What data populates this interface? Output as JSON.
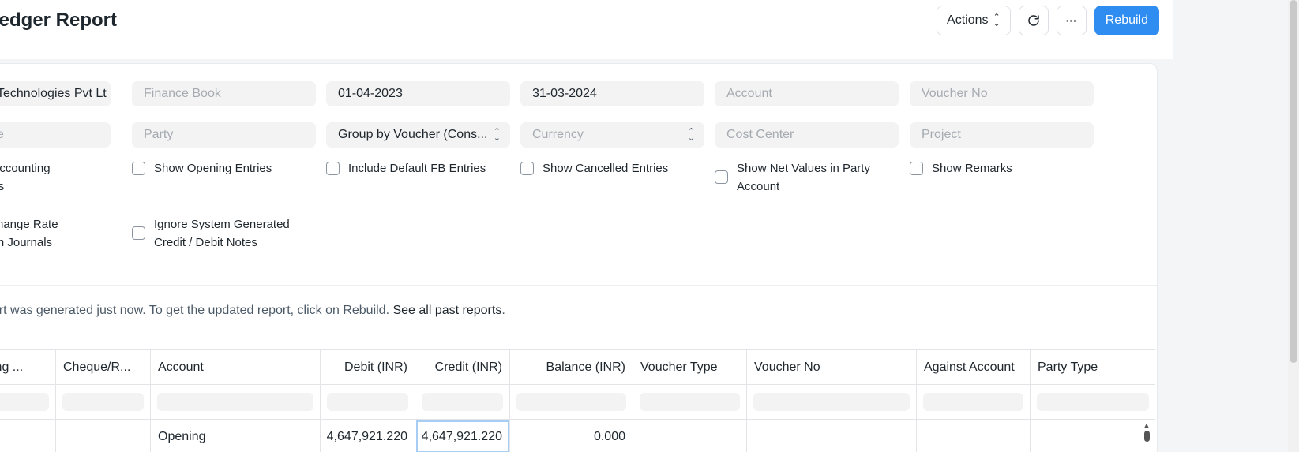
{
  "header": {
    "title": "Ledger Report",
    "actions_label": "Actions",
    "rebuild_label": "Rebuild",
    "more_label": "···"
  },
  "filters": {
    "company": "Technologies Pvt Lt",
    "finance_book_placeholder": "Finance Book",
    "from_date": "01-04-2023",
    "to_date": "31-03-2024",
    "account_placeholder": "Account",
    "voucher_no_placeholder": "Voucher No",
    "party_type_placeholder": "e",
    "party_placeholder": "Party",
    "group_by": "Group by Voucher (Cons...",
    "currency_placeholder": "Currency",
    "cost_center_placeholder": "Cost Center",
    "project_placeholder": "Project"
  },
  "checkboxes": {
    "accounting_dimensions": [
      "r Accounting",
      "ons"
    ],
    "show_opening_entries": "Show Opening Entries",
    "include_default_fb": "Include Default FB Entries",
    "show_cancelled": "Show Cancelled Entries",
    "show_net_values": [
      "Show Net Values in Party",
      "Account"
    ],
    "show_remarks": "Show Remarks",
    "exchange_rate_journals": [
      "xchange Rate",
      "tion Journals"
    ],
    "ignore_system_generated": [
      "Ignore System Generated",
      "Credit / Debit Notes"
    ]
  },
  "notice": {
    "text": "port was generated just now. To get the updated report, click on Rebuild. ",
    "link": "See all past reports",
    "end": "."
  },
  "table": {
    "columns": [
      "ing ...",
      "Cheque/R...",
      "Account",
      "Debit (INR)",
      "Credit (INR)",
      "Balance (INR)",
      "Voucher Type",
      "Voucher No",
      "Against Account",
      "Party Type"
    ],
    "rows": [
      [
        "",
        "",
        "Opening",
        "4,647,921.220",
        "4,647,921.220",
        "0.000",
        "",
        "",
        "",
        ""
      ]
    ]
  },
  "icons": {
    "refresh": "refresh-icon",
    "sort": "sort-caret-icon"
  }
}
